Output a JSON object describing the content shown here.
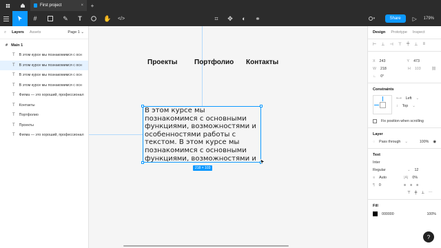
{
  "topbar": {
    "tab_title": "First project",
    "add_tab": "+"
  },
  "toolbar": {
    "share_label": "Share",
    "zoom": "179%"
  },
  "left_panel": {
    "tab_layers": "Layers",
    "tab_assets": "Assets",
    "page_selector": "Page 1",
    "frame_name": "Main 1",
    "layers": [
      {
        "label": "В этом курсе мы познакомимся с осн",
        "selected": false
      },
      {
        "label": "В этом курсе мы познакомимся с осн",
        "selected": true
      },
      {
        "label": "В этом курсе мы познакомимся с осн",
        "selected": false
      },
      {
        "label": "В этом курсе мы познакомимся с осн",
        "selected": false
      },
      {
        "label": "Фигма — это хороший, профессионал",
        "selected": false
      },
      {
        "label": "Контакты",
        "selected": false
      },
      {
        "label": "Портфолио",
        "selected": false
      },
      {
        "label": "Проекты",
        "selected": false
      },
      {
        "label": "Фигма — это хороший, профессионал",
        "selected": false
      }
    ]
  },
  "canvas": {
    "nav": [
      "Проекты",
      "Портфолио",
      "Контакты"
    ],
    "text_block": "В этом курсе мы познакомимся с основными функциями, возможностями и особенностями работы с текстом.  В этом курсе мы познакомимся с основными функциями, возможностями и особенностями работы с текстом.",
    "dimension_badge": "218 × 103"
  },
  "right_panel": {
    "tab_design": "Design",
    "tab_prototype": "Prototype",
    "tab_inspect": "Inspect",
    "x_label": "X",
    "x": "243",
    "y_label": "Y",
    "y": "473",
    "w_label": "W",
    "w": "218",
    "h_label": "H",
    "h": "103",
    "rotation": "0°",
    "constraints_title": "Constraints",
    "constraint_h": "Left",
    "constraint_v": "Top",
    "fix_position": "Fix position when scrolling",
    "layer_title": "Layer",
    "blend": "Pass through",
    "opacity": "100%",
    "text_title": "Text",
    "font_family": "Inter",
    "font_weight": "Regular",
    "font_size": "12",
    "line_height": "Auto",
    "letter_spacing": "0%",
    "paragraph": "0",
    "fill_title": "Fill",
    "fill_hex": "000000",
    "fill_opacity": "100%"
  },
  "help_label": "?"
}
